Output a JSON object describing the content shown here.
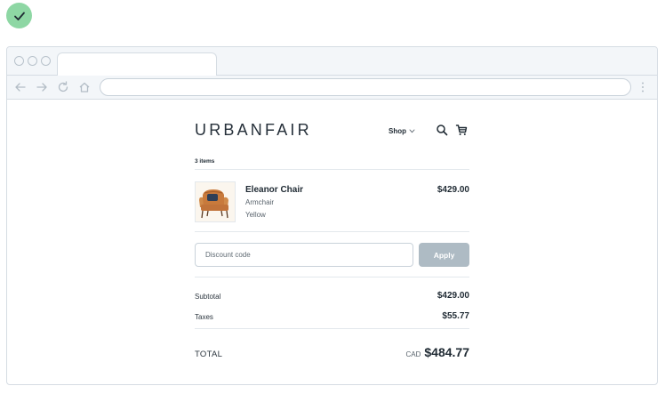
{
  "store": {
    "logo": "URBANFAIR",
    "shop_label": "Shop"
  },
  "cart": {
    "items_count": "3 items",
    "item": {
      "name": "Eleanor Chair",
      "type": "Armchair",
      "color": "Yellow",
      "price": "$429.00"
    },
    "discount": {
      "placeholder": "Discount code",
      "apply_label": "Apply"
    },
    "subtotal_label": "Subtotal",
    "subtotal": "$429.00",
    "taxes_label": "Taxes",
    "taxes": "$55.77",
    "total_label": "TOTAL",
    "currency": "CAD",
    "total": "$484.77"
  },
  "colors": {
    "success_badge": "#8ed7a4",
    "apply_button": "#aebbc4",
    "browser_chrome": "#f3f6f9"
  },
  "icons": [
    "check-icon",
    "back-arrow-icon",
    "forward-arrow-icon",
    "reload-icon",
    "home-icon",
    "kebab-menu-icon",
    "chevron-down-icon",
    "search-icon",
    "cart-icon",
    "product-image-chair"
  ]
}
